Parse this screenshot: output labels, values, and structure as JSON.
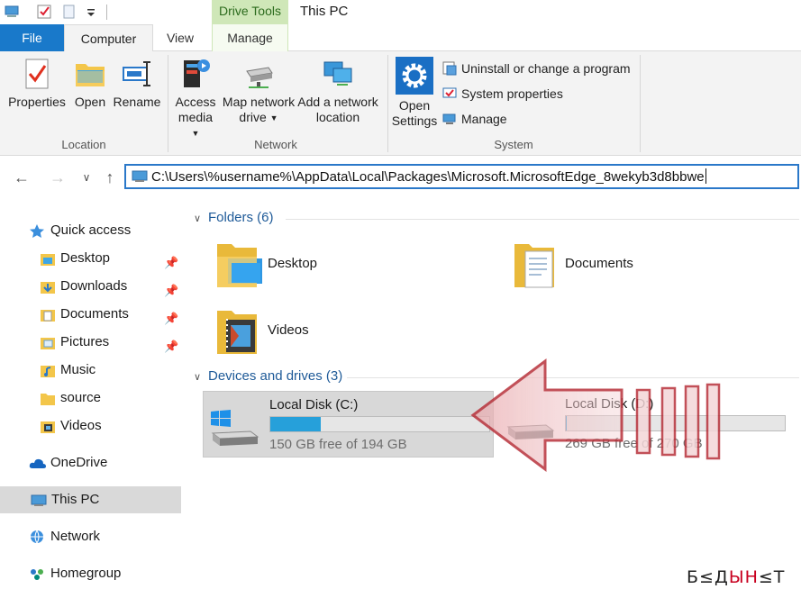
{
  "window": {
    "title": "This PC",
    "context_tab_group": "Drive Tools"
  },
  "tabs": [
    {
      "label": "File"
    },
    {
      "label": "Computer"
    },
    {
      "label": "View"
    },
    {
      "label": "Manage"
    }
  ],
  "ribbon": {
    "location": {
      "label": "Location",
      "properties": "Properties",
      "open": "Open",
      "rename": "Rename"
    },
    "network": {
      "label": "Network",
      "access_media_1": "Access",
      "access_media_2": "media",
      "map_drive_1": "Map network",
      "map_drive_2": "drive",
      "add_location_1": "Add a network",
      "add_location_2": "location"
    },
    "system": {
      "label": "System",
      "open_settings_1": "Open",
      "open_settings_2": "Settings",
      "uninstall": "Uninstall or change a program",
      "system_properties": "System properties",
      "manage": "Manage"
    }
  },
  "address": {
    "path": "C:\\Users\\%username%\\AppData\\Local\\Packages\\Microsoft.MicrosoftEdge_8wekyb3d8bbwe"
  },
  "nav": {
    "quick_access": "Quick access",
    "items": [
      {
        "label": "Desktop",
        "pinned": true
      },
      {
        "label": "Downloads",
        "pinned": true
      },
      {
        "label": "Documents",
        "pinned": true
      },
      {
        "label": "Pictures",
        "pinned": true
      },
      {
        "label": "Music",
        "pinned": false
      },
      {
        "label": "source",
        "pinned": false
      },
      {
        "label": "Videos",
        "pinned": false
      }
    ],
    "onedrive": "OneDrive",
    "this_pc": "This PC",
    "network": "Network",
    "homegroup": "Homegroup"
  },
  "content": {
    "folders_header": "Folders (6)",
    "folders": [
      {
        "label": "Desktop"
      },
      {
        "label": "Documents"
      },
      {
        "label": "Videos"
      }
    ],
    "devices_header": "Devices and drives (3)",
    "drives": [
      {
        "name": "Local Disk (C:)",
        "free": "150 GB free of 194 GB",
        "used_fraction": 0.23
      },
      {
        "name": "Local Disk (D:)",
        "free": "269 GB free of 270 GB",
        "used_fraction": 0.004
      }
    ]
  },
  "watermark": {
    "part1": "Б≤Д",
    "part2": "ЫН",
    "part3": "≤Т"
  },
  "colors": {
    "accent": "#1979ca",
    "drive_bar": "#26a0da",
    "context_tab": "#cfe7b8",
    "section_header": "#1e5a98"
  }
}
